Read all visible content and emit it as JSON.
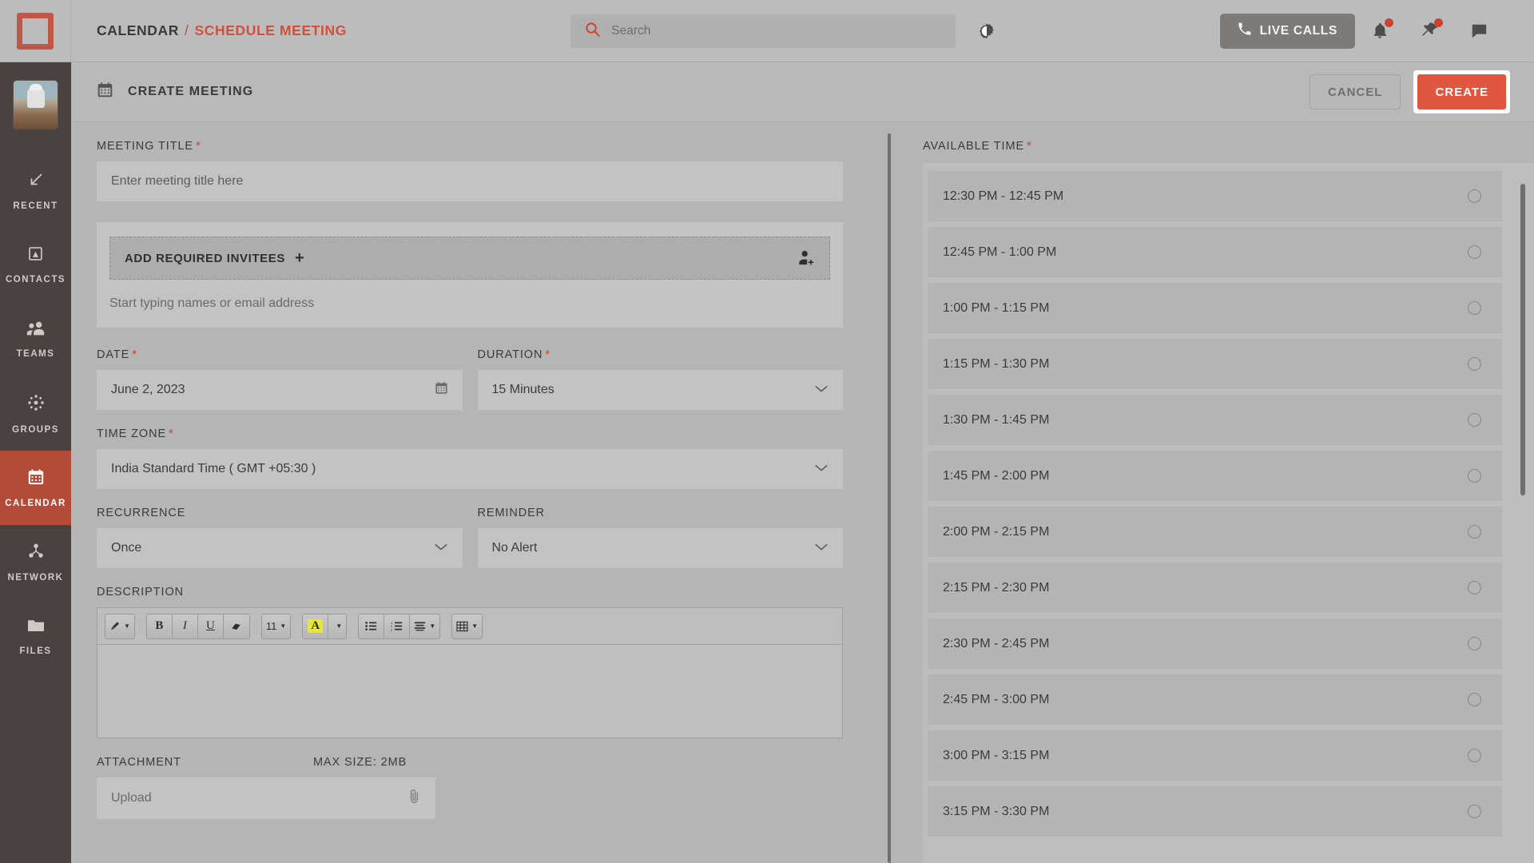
{
  "brand": {
    "accent": "#d0503c",
    "sidebar_active": "#b44a38",
    "create_btn": "#e0563f"
  },
  "topbar": {
    "breadcrumb_root": "CALENDAR",
    "breadcrumb_sep": "/",
    "breadcrumb_current": "SCHEDULE MEETING",
    "search_placeholder": "Search",
    "search_value": "",
    "live_calls_label": "LIVE CALLS"
  },
  "sidebar": {
    "items": [
      {
        "label": "RECENT",
        "icon": "arrow-down-left-icon",
        "active": false
      },
      {
        "label": "CONTACTS",
        "icon": "contact-card-icon",
        "active": false
      },
      {
        "label": "TEAMS",
        "icon": "people-icon",
        "active": false
      },
      {
        "label": "GROUPS",
        "icon": "groups-dots-icon",
        "active": false
      },
      {
        "label": "CALENDAR",
        "icon": "calendar-icon",
        "active": true
      },
      {
        "label": "NETWORK",
        "icon": "network-nodes-icon",
        "active": false
      },
      {
        "label": "FILES",
        "icon": "folder-icon",
        "active": false
      }
    ]
  },
  "page": {
    "title": "CREATE MEETING",
    "cancel_label": "CANCEL",
    "create_label": "CREATE"
  },
  "form": {
    "meeting_title": {
      "label": "MEETING TITLE",
      "required": true,
      "placeholder": "Enter meeting title here",
      "value": ""
    },
    "invitees": {
      "add_label": "ADD REQUIRED INVITEES",
      "add_plus": "+",
      "placeholder": "Start typing names or email address",
      "value": ""
    },
    "date": {
      "label": "DATE",
      "required": true,
      "value": "June 2, 2023"
    },
    "duration": {
      "label": "DURATION",
      "required": true,
      "value": "15 Minutes"
    },
    "time_zone": {
      "label": "TIME ZONE",
      "required": true,
      "value": "India Standard Time ( GMT +05:30 )"
    },
    "recurrence": {
      "label": "RECURRENCE",
      "required": false,
      "value": "Once"
    },
    "reminder": {
      "label": "REMINDER",
      "required": false,
      "value": "No Alert"
    },
    "description": {
      "label": "DESCRIPTION",
      "value": "",
      "toolbar": {
        "font_size": "11",
        "bold": "B",
        "italic": "I",
        "underline": "U",
        "highlight_letter": "A"
      }
    },
    "attachment": {
      "label": "ATTACHMENT",
      "max_size": "MAX SIZE: 2MB",
      "placeholder": "Upload",
      "value": ""
    }
  },
  "available_time": {
    "label": "AVAILABLE TIME",
    "required": true,
    "slots": [
      "12:30 PM - 12:45 PM",
      "12:45 PM - 1:00 PM",
      "1:00 PM - 1:15 PM",
      "1:15 PM - 1:30 PM",
      "1:30 PM - 1:45 PM",
      "1:45 PM - 2:00 PM",
      "2:00 PM - 2:15 PM",
      "2:15 PM - 2:30 PM",
      "2:30 PM - 2:45 PM",
      "2:45 PM - 3:00 PM",
      "3:00 PM - 3:15 PM",
      "3:15 PM - 3:30 PM"
    ]
  }
}
